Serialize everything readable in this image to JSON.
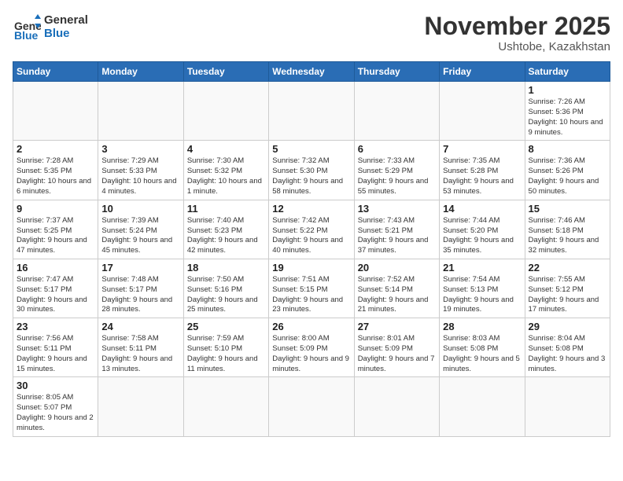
{
  "header": {
    "logo_general": "General",
    "logo_blue": "Blue",
    "month_title": "November 2025",
    "location": "Ushtobe, Kazakhstan"
  },
  "weekdays": [
    "Sunday",
    "Monday",
    "Tuesday",
    "Wednesday",
    "Thursday",
    "Friday",
    "Saturday"
  ],
  "weeks": [
    [
      {
        "day": "",
        "info": ""
      },
      {
        "day": "",
        "info": ""
      },
      {
        "day": "",
        "info": ""
      },
      {
        "day": "",
        "info": ""
      },
      {
        "day": "",
        "info": ""
      },
      {
        "day": "",
        "info": ""
      },
      {
        "day": "1",
        "info": "Sunrise: 7:26 AM\nSunset: 5:36 PM\nDaylight: 10 hours\nand 9 minutes."
      }
    ],
    [
      {
        "day": "2",
        "info": "Sunrise: 7:28 AM\nSunset: 5:35 PM\nDaylight: 10 hours\nand 6 minutes."
      },
      {
        "day": "3",
        "info": "Sunrise: 7:29 AM\nSunset: 5:33 PM\nDaylight: 10 hours\nand 4 minutes."
      },
      {
        "day": "4",
        "info": "Sunrise: 7:30 AM\nSunset: 5:32 PM\nDaylight: 10 hours\nand 1 minute."
      },
      {
        "day": "5",
        "info": "Sunrise: 7:32 AM\nSunset: 5:30 PM\nDaylight: 9 hours\nand 58 minutes."
      },
      {
        "day": "6",
        "info": "Sunrise: 7:33 AM\nSunset: 5:29 PM\nDaylight: 9 hours\nand 55 minutes."
      },
      {
        "day": "7",
        "info": "Sunrise: 7:35 AM\nSunset: 5:28 PM\nDaylight: 9 hours\nand 53 minutes."
      },
      {
        "day": "8",
        "info": "Sunrise: 7:36 AM\nSunset: 5:26 PM\nDaylight: 9 hours\nand 50 minutes."
      }
    ],
    [
      {
        "day": "9",
        "info": "Sunrise: 7:37 AM\nSunset: 5:25 PM\nDaylight: 9 hours\nand 47 minutes."
      },
      {
        "day": "10",
        "info": "Sunrise: 7:39 AM\nSunset: 5:24 PM\nDaylight: 9 hours\nand 45 minutes."
      },
      {
        "day": "11",
        "info": "Sunrise: 7:40 AM\nSunset: 5:23 PM\nDaylight: 9 hours\nand 42 minutes."
      },
      {
        "day": "12",
        "info": "Sunrise: 7:42 AM\nSunset: 5:22 PM\nDaylight: 9 hours\nand 40 minutes."
      },
      {
        "day": "13",
        "info": "Sunrise: 7:43 AM\nSunset: 5:21 PM\nDaylight: 9 hours\nand 37 minutes."
      },
      {
        "day": "14",
        "info": "Sunrise: 7:44 AM\nSunset: 5:20 PM\nDaylight: 9 hours\nand 35 minutes."
      },
      {
        "day": "15",
        "info": "Sunrise: 7:46 AM\nSunset: 5:18 PM\nDaylight: 9 hours\nand 32 minutes."
      }
    ],
    [
      {
        "day": "16",
        "info": "Sunrise: 7:47 AM\nSunset: 5:17 PM\nDaylight: 9 hours\nand 30 minutes."
      },
      {
        "day": "17",
        "info": "Sunrise: 7:48 AM\nSunset: 5:17 PM\nDaylight: 9 hours\nand 28 minutes."
      },
      {
        "day": "18",
        "info": "Sunrise: 7:50 AM\nSunset: 5:16 PM\nDaylight: 9 hours\nand 25 minutes."
      },
      {
        "day": "19",
        "info": "Sunrise: 7:51 AM\nSunset: 5:15 PM\nDaylight: 9 hours\nand 23 minutes."
      },
      {
        "day": "20",
        "info": "Sunrise: 7:52 AM\nSunset: 5:14 PM\nDaylight: 9 hours\nand 21 minutes."
      },
      {
        "day": "21",
        "info": "Sunrise: 7:54 AM\nSunset: 5:13 PM\nDaylight: 9 hours\nand 19 minutes."
      },
      {
        "day": "22",
        "info": "Sunrise: 7:55 AM\nSunset: 5:12 PM\nDaylight: 9 hours\nand 17 minutes."
      }
    ],
    [
      {
        "day": "23",
        "info": "Sunrise: 7:56 AM\nSunset: 5:11 PM\nDaylight: 9 hours\nand 15 minutes."
      },
      {
        "day": "24",
        "info": "Sunrise: 7:58 AM\nSunset: 5:11 PM\nDaylight: 9 hours\nand 13 minutes."
      },
      {
        "day": "25",
        "info": "Sunrise: 7:59 AM\nSunset: 5:10 PM\nDaylight: 9 hours\nand 11 minutes."
      },
      {
        "day": "26",
        "info": "Sunrise: 8:00 AM\nSunset: 5:09 PM\nDaylight: 9 hours\nand 9 minutes."
      },
      {
        "day": "27",
        "info": "Sunrise: 8:01 AM\nSunset: 5:09 PM\nDaylight: 9 hours\nand 7 minutes."
      },
      {
        "day": "28",
        "info": "Sunrise: 8:03 AM\nSunset: 5:08 PM\nDaylight: 9 hours\nand 5 minutes."
      },
      {
        "day": "29",
        "info": "Sunrise: 8:04 AM\nSunset: 5:08 PM\nDaylight: 9 hours\nand 3 minutes."
      }
    ],
    [
      {
        "day": "30",
        "info": "Sunrise: 8:05 AM\nSunset: 5:07 PM\nDaylight: 9 hours\nand 2 minutes."
      },
      {
        "day": "",
        "info": ""
      },
      {
        "day": "",
        "info": ""
      },
      {
        "day": "",
        "info": ""
      },
      {
        "day": "",
        "info": ""
      },
      {
        "day": "",
        "info": ""
      },
      {
        "day": "",
        "info": ""
      }
    ]
  ]
}
